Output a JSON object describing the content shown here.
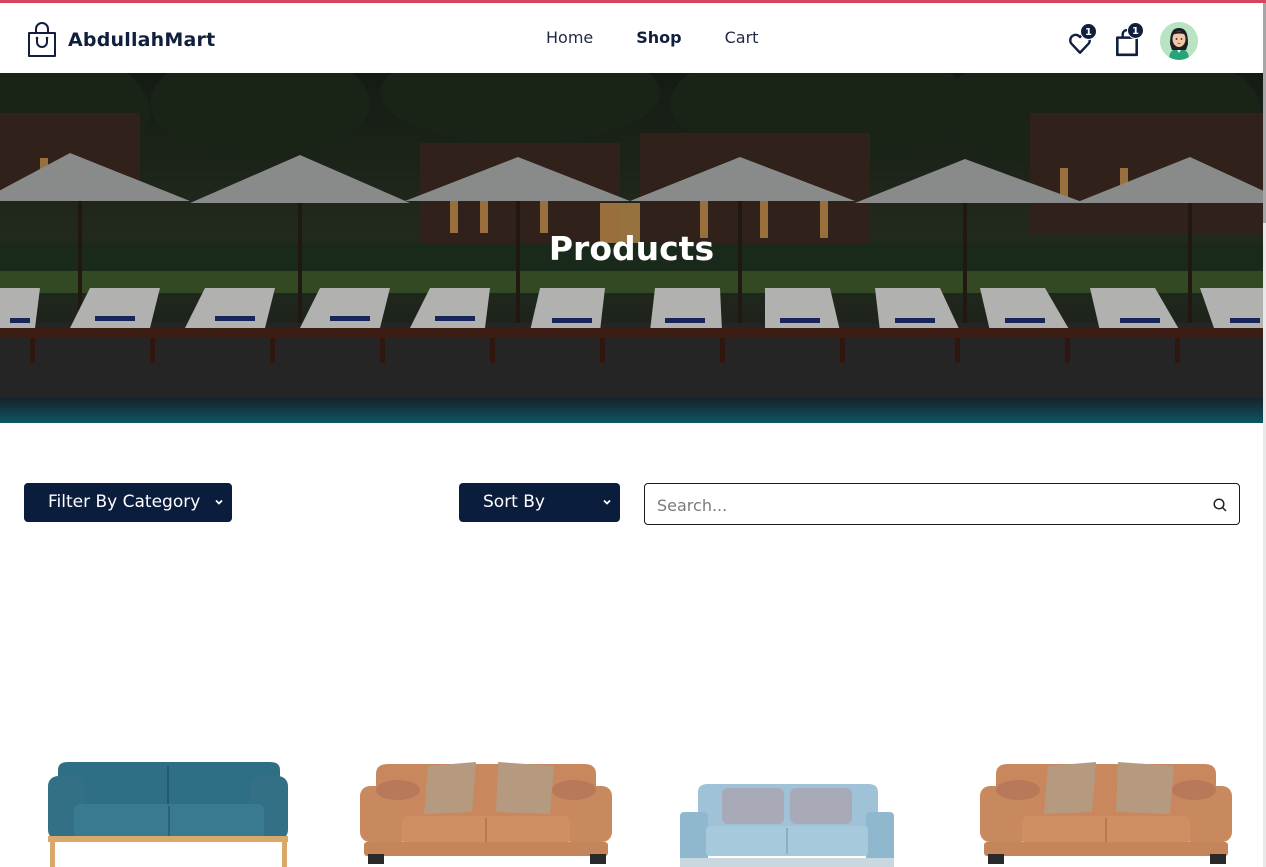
{
  "brand": {
    "name": "AbdullahMart",
    "icon": "shopping-bag-icon"
  },
  "nav": {
    "links": [
      {
        "label": "Home",
        "active": false
      },
      {
        "label": "Shop",
        "active": true
      },
      {
        "label": "Cart",
        "active": false
      }
    ]
  },
  "header_icons": {
    "wishlist": {
      "icon": "heart-icon",
      "count": "1"
    },
    "cart": {
      "icon": "shopping-bag-icon",
      "count": "1"
    },
    "profile": {
      "icon": "avatar"
    }
  },
  "hero": {
    "title": "Products"
  },
  "filters": {
    "category": {
      "selected": "Filter By Category"
    },
    "sort": {
      "selected": "Sort By"
    },
    "search": {
      "placeholder": "Search..."
    }
  },
  "products": [
    {
      "image": "teal-sofa"
    },
    {
      "image": "tan-sofa"
    },
    {
      "image": "light-blue-sofa"
    },
    {
      "image": "tan-sofa"
    }
  ],
  "colors": {
    "accent_line": "#d6455f",
    "navy": "#0b1d3d"
  }
}
